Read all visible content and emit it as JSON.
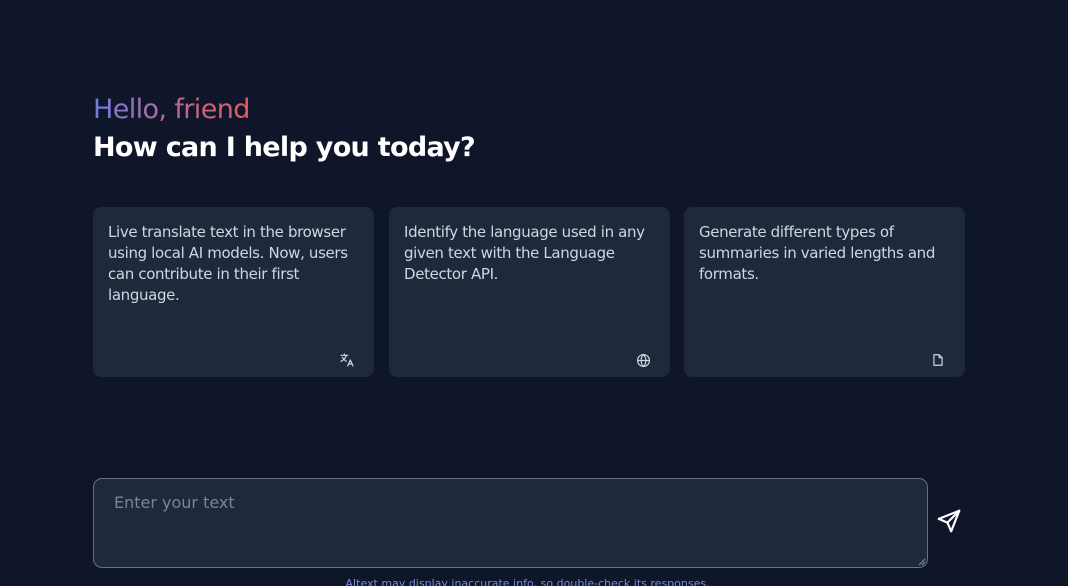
{
  "header": {
    "greeting": "Hello, friend",
    "title": "How can I help you today?"
  },
  "cards": [
    {
      "text": "Live translate text in the browser using local AI models. Now, users can contribute in their first language.",
      "icon": "translate-icon"
    },
    {
      "text": "Identify the language used in any given text with the Language Detector API.",
      "icon": "globe-icon"
    },
    {
      "text": "Generate different types of summaries in varied lengths and formats.",
      "icon": "document-icon"
    }
  ],
  "composer": {
    "placeholder": "Enter your text",
    "value": "",
    "send_icon": "send-icon"
  },
  "footer": {
    "disclaimer": "AItext may display inaccurate info, so double-check its responses."
  },
  "colors": {
    "background": "#0f1629",
    "card": "#1e293b",
    "gradient_start": "#6b7fe0",
    "gradient_end": "#e25c5c",
    "disclaimer": "#7a86e8"
  }
}
